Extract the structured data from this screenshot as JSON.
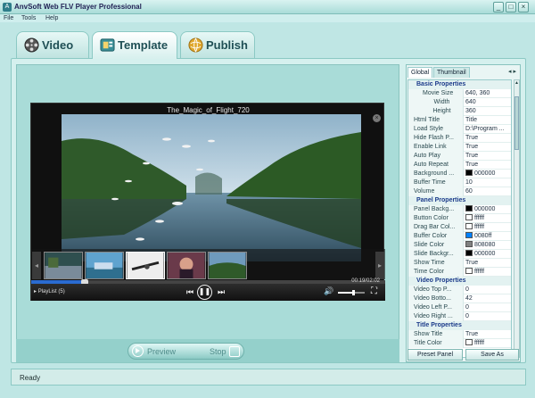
{
  "window": {
    "title": "AnvSoft Web FLV Player Professional",
    "minimize_label": "_",
    "maximize_label": "□",
    "close_label": "×"
  },
  "menu": [
    "File",
    "Tools",
    "Help"
  ],
  "tabs": [
    {
      "label": "Video",
      "icon": "film-reel-icon"
    },
    {
      "label": "Template",
      "icon": "template-icon",
      "active": true
    },
    {
      "label": "Publish",
      "icon": "globe-icon"
    }
  ],
  "player": {
    "title": "The_Magic_of_Flight_720",
    "time": "00:19/02:02",
    "playlist": "PlayList",
    "playlist_count": "(5)",
    "progress": 0.15,
    "volume": 0.55,
    "prev_icon": "prev-track-icon",
    "pause_icon": "pause-icon",
    "next_icon": "next-track-icon",
    "volume_icon": "speaker-icon",
    "fullscreen_icon": "fullscreen-icon"
  },
  "bottom_controls": {
    "preview": "Preview",
    "stop": "Stop"
  },
  "side_panel": {
    "tabs": [
      "Global",
      "Thumbnail"
    ],
    "arrows": "◂ ▸",
    "preset_button": "Preset Panel",
    "save_button": "Save As",
    "rows": [
      {
        "type": "section",
        "name": "Basic Properties",
        "sign": "⊟"
      },
      {
        "type": "group",
        "name": "Movie Size",
        "value": "640, 360",
        "sign": "⊟"
      },
      {
        "type": "sub",
        "name": "Width",
        "value": "640"
      },
      {
        "type": "sub",
        "name": "Height",
        "value": "360"
      },
      {
        "type": "row",
        "name": "Html Title",
        "value": "Title"
      },
      {
        "type": "row",
        "name": "Load Style",
        "value": "D:\\Program ..."
      },
      {
        "type": "row",
        "name": "Hide Flash P...",
        "value": "True"
      },
      {
        "type": "row",
        "name": "Enable Link",
        "value": "True"
      },
      {
        "type": "row",
        "name": "Auto Play",
        "value": "True"
      },
      {
        "type": "row",
        "name": "Auto Repeat",
        "value": "True"
      },
      {
        "type": "row",
        "name": "Background ...",
        "value": "000000",
        "swatch": "#000000"
      },
      {
        "type": "row",
        "name": "Buffer Time",
        "value": "10"
      },
      {
        "type": "row",
        "name": "Volume",
        "value": "60"
      },
      {
        "type": "section",
        "name": "Panel Properties",
        "sign": "⊟"
      },
      {
        "type": "row",
        "name": "Panel Backg...",
        "value": "000000",
        "swatch": "#000000"
      },
      {
        "type": "row",
        "name": "Button Color",
        "value": "ffffff",
        "swatch": "#ffffff"
      },
      {
        "type": "row",
        "name": "Drag Bar Col...",
        "value": "ffffff",
        "swatch": "#ffffff"
      },
      {
        "type": "row",
        "name": "Buffer Color",
        "value": "0080ff",
        "swatch": "#0080ff"
      },
      {
        "type": "row",
        "name": "Slide Color",
        "value": "808080",
        "swatch": "#808080"
      },
      {
        "type": "row",
        "name": "Slide Backgr...",
        "value": "000000",
        "swatch": "#000000"
      },
      {
        "type": "row",
        "name": "Show Time",
        "value": "True"
      },
      {
        "type": "row",
        "name": "Time Color",
        "value": "ffffff",
        "swatch": "#ffffff"
      },
      {
        "type": "section",
        "name": "Video Properties",
        "sign": "⊟"
      },
      {
        "type": "row",
        "name": "Video Top P...",
        "value": "0"
      },
      {
        "type": "row",
        "name": "Video Botto...",
        "value": "42"
      },
      {
        "type": "row",
        "name": "Video Left P...",
        "value": "0"
      },
      {
        "type": "row",
        "name": "Video Right ...",
        "value": "0"
      },
      {
        "type": "section",
        "name": "Title Properties",
        "sign": "⊟"
      },
      {
        "type": "row",
        "name": "Show Title",
        "value": "True"
      },
      {
        "type": "row",
        "name": "Title Color",
        "value": "ffffff",
        "swatch": "#ffffff"
      }
    ]
  },
  "status": "Ready",
  "colors": {
    "accent": "#2a6bd1",
    "window_bg": "#bfe6e4"
  }
}
